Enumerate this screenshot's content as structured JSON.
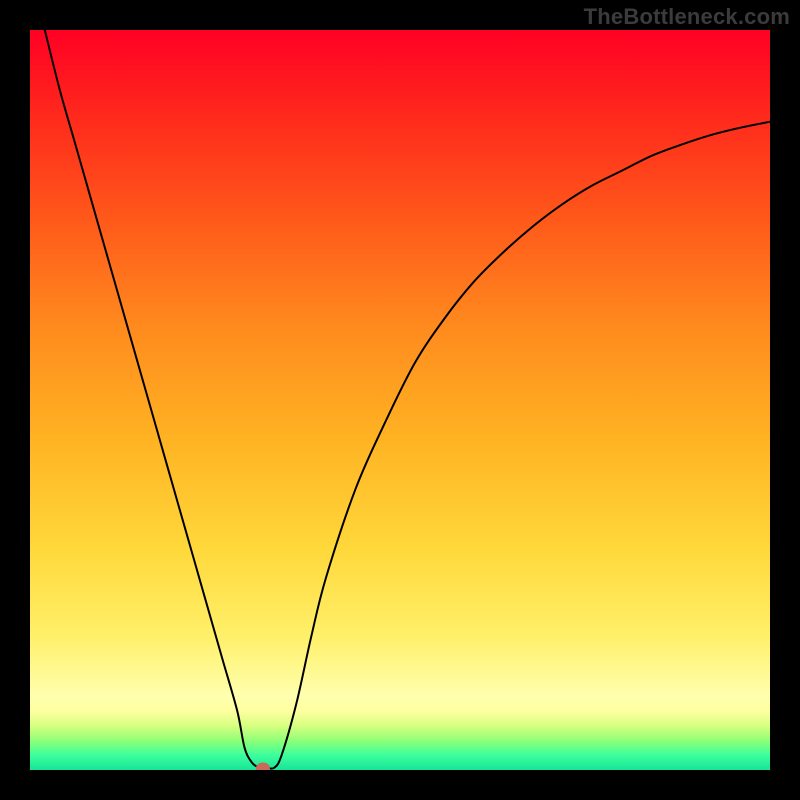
{
  "watermark": {
    "text": "TheBottleneck.com"
  },
  "chart_data": {
    "type": "line",
    "title": "",
    "xlabel": "",
    "ylabel": "",
    "xlim": [
      0,
      100
    ],
    "ylim": [
      0,
      100
    ],
    "series": [
      {
        "name": "bottleneck-curve",
        "x": [
          2,
          4,
          6,
          8,
          10,
          12,
          14,
          16,
          18,
          20,
          22,
          24,
          26,
          28,
          29,
          30,
          31,
          32,
          33,
          34,
          36,
          38,
          40,
          44,
          48,
          52,
          56,
          60,
          64,
          68,
          72,
          76,
          80,
          84,
          88,
          92,
          96,
          100
        ],
        "y": [
          100,
          92,
          85,
          78,
          71,
          64,
          57,
          50,
          43,
          36,
          29,
          22,
          15,
          8,
          3,
          1,
          0.3,
          0.3,
          0.3,
          2,
          9,
          18,
          26,
          38,
          47,
          55,
          61,
          66,
          70,
          73.5,
          76.5,
          79,
          81,
          83,
          84.5,
          85.8,
          86.8,
          87.6
        ]
      }
    ],
    "marker": {
      "x": 31.5,
      "y": 0.3
    },
    "gradient_stops": [
      {
        "pos": 0,
        "color": "#ff0024"
      },
      {
        "pos": 12,
        "color": "#ff2a1c"
      },
      {
        "pos": 26,
        "color": "#ff5a1a"
      },
      {
        "pos": 40,
        "color": "#ff8a1e"
      },
      {
        "pos": 55,
        "color": "#ffb222"
      },
      {
        "pos": 70,
        "color": "#ffd83a"
      },
      {
        "pos": 82,
        "color": "#fff06a"
      },
      {
        "pos": 90,
        "color": "#ffffae"
      },
      {
        "pos": 92,
        "color": "#fdffa0"
      },
      {
        "pos": 94,
        "color": "#d8ff80"
      },
      {
        "pos": 96,
        "color": "#90ff78"
      },
      {
        "pos": 98,
        "color": "#3cff9c"
      },
      {
        "pos": 100,
        "color": "#17e49a"
      }
    ]
  }
}
